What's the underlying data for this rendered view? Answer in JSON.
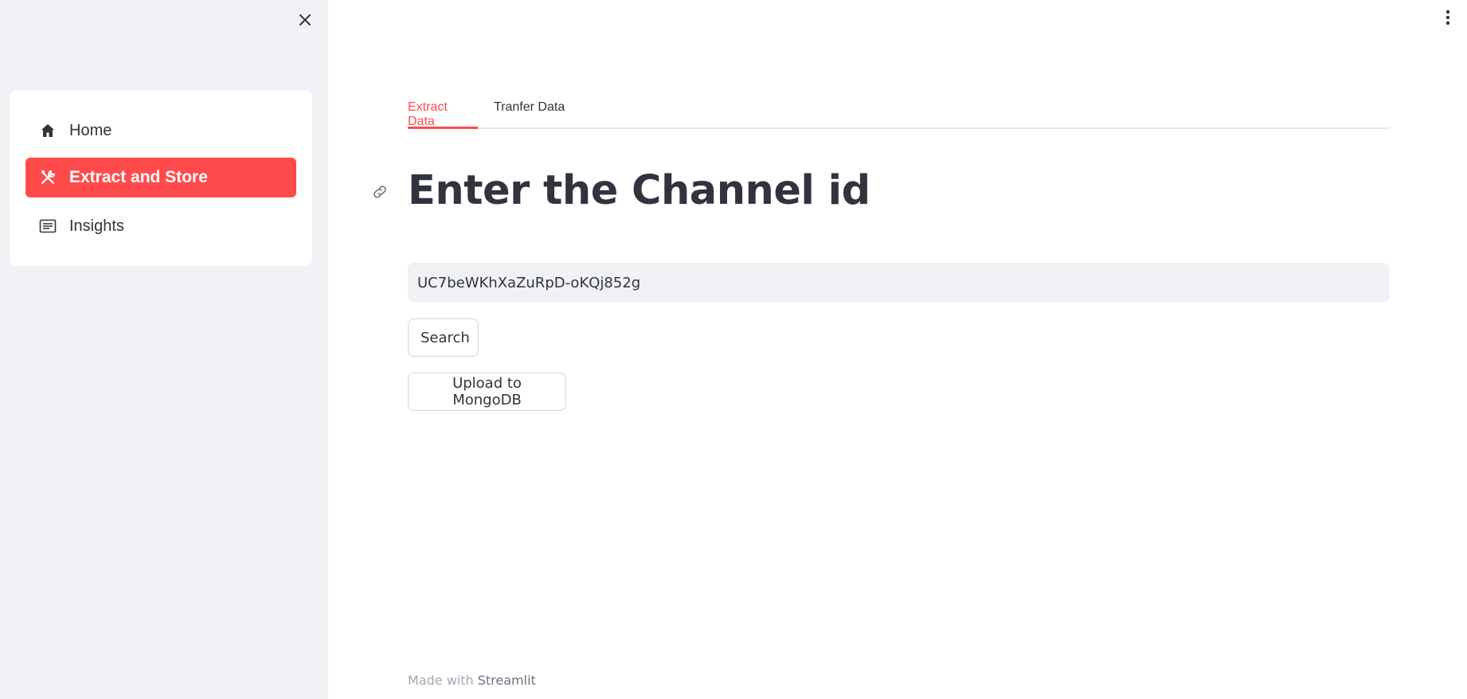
{
  "sidebar": {
    "close_icon": "close-icon",
    "items": [
      {
        "label": "Home",
        "icon": "home-icon",
        "selected": false
      },
      {
        "label": "Extract and Store",
        "icon": "tools-icon",
        "selected": true
      },
      {
        "label": "Insights",
        "icon": "list-icon",
        "selected": false
      }
    ]
  },
  "main_menu_icon": "kebab-menu-icon",
  "tabs": [
    {
      "label": "Extract Data",
      "active": true
    },
    {
      "label": "Tranfer Data",
      "active": false
    }
  ],
  "heading": {
    "title": "Enter the Channel id",
    "anchor_icon": "link-icon"
  },
  "channel_input": {
    "value": "UC7beWKhXaZuRpD-oKQj852g"
  },
  "buttons": {
    "search_label": "Search",
    "upload_label": "Upload to MongoDB"
  },
  "footer": {
    "prefix": "Made with",
    "brand": "Streamlit"
  },
  "colors": {
    "accent": "#ff4b4b",
    "sidebar_bg": "#f0f2f6",
    "text": "#31333f"
  }
}
